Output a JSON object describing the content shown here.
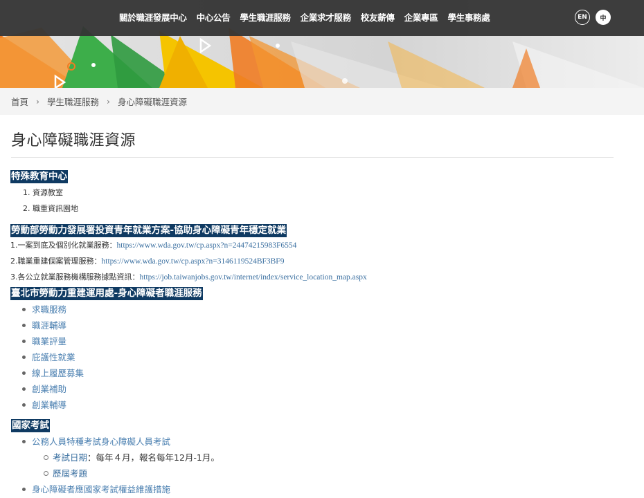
{
  "nav": {
    "items": [
      "關於職涯發展中心",
      "中心公告",
      "學生職涯服務",
      "企業求才服務",
      "校友薪傳",
      "企業專區",
      "學生事務處"
    ],
    "lang_en": "EN",
    "lang_zh": "中"
  },
  "breadcrumb": {
    "home": "首頁",
    "sep": "›",
    "level1": "學生職涯服務",
    "current": "身心障礙職涯資源"
  },
  "page": {
    "title": "身心障礙職涯資源"
  },
  "sections": {
    "special_ed": {
      "heading": "特殊教育中心",
      "items": [
        "資源教室",
        "職重資訊園地"
      ]
    },
    "labor_ministry": {
      "heading": "勞動部勞動力發展署投資青年就業方案-協助身心障礙青年穩定就業",
      "lines": [
        {
          "label": "1.一案到底及個別化就業服務：",
          "url": "https://www.wda.gov.tw/cp.aspx?n=24474215983F6554"
        },
        {
          "label": "2.職業重建個案管理服務：",
          "url": "https://www.wda.gov.tw/cp.aspx?n=3146119524BF3BF9"
        },
        {
          "label": "3.各公立就業服務機構服務據點資訊：",
          "url": "https://job.taiwanjobs.gov.tw/internet/index/service_location_map.aspx"
        }
      ]
    },
    "taipei": {
      "heading": "臺北市勞動力重建運用處-身心障礙者職涯服務",
      "items": [
        "求職服務",
        "職涯輔導",
        "職業評量",
        "庇護性就業",
        "線上履歷募集",
        "創業補助",
        "創業輔導"
      ]
    },
    "exam": {
      "heading": "國家考試",
      "item1": "公務人員特種考試身心障礙人員考試",
      "sub1_link": "考試日期",
      "sub1_text": "：每年４月，報名每年12月-1月。",
      "sub2": "歷屆考題",
      "item2": "身心障礙者應國家考試權益維護措施"
    }
  },
  "colors": {
    "nav_bg": "#343434",
    "heading_highlight": "#0f3a62",
    "link": "#3a6fa0"
  }
}
